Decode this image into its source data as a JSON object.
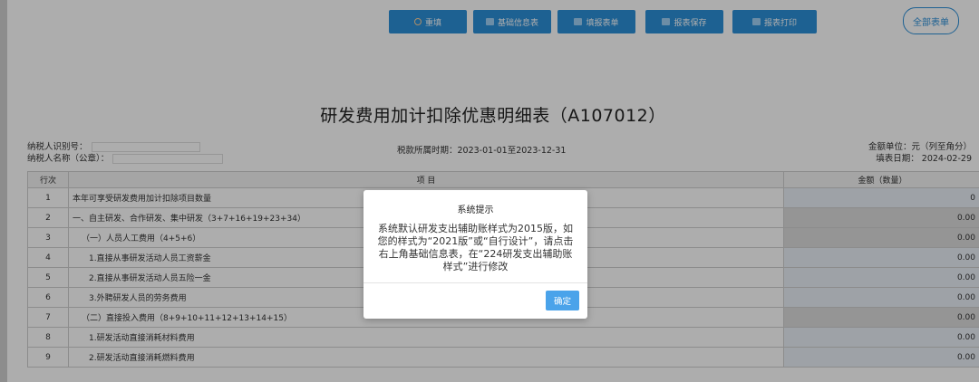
{
  "toolbar": {
    "buttons": [
      {
        "label": "重填",
        "icon": "reset-icon"
      },
      {
        "label": "基础信息表",
        "icon": "grid-icon"
      },
      {
        "label": "填报表单",
        "icon": "grid-icon"
      },
      {
        "label": "报表保存",
        "icon": "save-icon"
      },
      {
        "label": "报表打印",
        "icon": "print-icon"
      }
    ],
    "all_forms": "全部表单"
  },
  "title": "研发费用加计扣除优惠明细表（A107012）",
  "meta": {
    "taxpayer_id_label": "纳税人识别号：",
    "taxpayer_name_label": "纳税人名称（公章）：",
    "period": "税款所属时期：2023-01-01至2023-12-31",
    "unit": "金额单位：元（列至角分）",
    "fill_date": "填表日期： 2024-02-29"
  },
  "table": {
    "headers": {
      "row": "行次",
      "item": "项 目",
      "amount": "金额（数量）"
    },
    "rows": [
      {
        "no": "1",
        "item": "本年可享受研发费用加计扣除项目数量",
        "amount": "0"
      },
      {
        "no": "2",
        "item": "一、自主研发、合作研发、集中研发（3+7+16+19+23+34）",
        "amount": "0.00"
      },
      {
        "no": "3",
        "item": "（一）人员人工费用（4+5+6）",
        "amount": "0.00"
      },
      {
        "no": "4",
        "item": "1.直接从事研发活动人员工资薪金",
        "amount": "0.00"
      },
      {
        "no": "5",
        "item": "2.直接从事研发活动人员五险一金",
        "amount": "0.00"
      },
      {
        "no": "6",
        "item": "3.外聘研发人员的劳务费用",
        "amount": "0.00"
      },
      {
        "no": "7",
        "item": "（二）直接投入费用（8+9+10+11+12+13+14+15）",
        "amount": "0.00"
      },
      {
        "no": "8",
        "item": "1.研发活动直接消耗材料费用",
        "amount": "0.00"
      },
      {
        "no": "9",
        "item": "2.研发活动直接消耗燃料费用",
        "amount": "0.00"
      }
    ]
  },
  "dialog": {
    "title": "系统提示",
    "message": "系统默认研发支出辅助账样式为2015版，如您的样式为“2021版”或“自行设计”，请点击右上角基础信息表，在“224研发支出辅助账样式”进行修改",
    "ok": "确定"
  }
}
